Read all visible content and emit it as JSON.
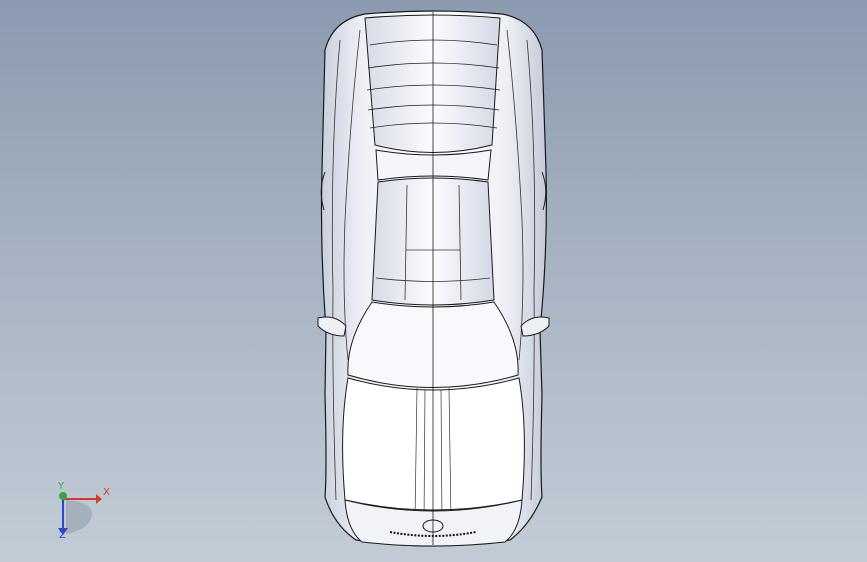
{
  "viewport": {
    "background_top": "#8b9aaf",
    "background_bottom": "#c3ccd6",
    "model": "car-body-top-view"
  },
  "triad": {
    "x_label": "X",
    "y_label": "Y",
    "z_label": "Z",
    "x_color": "#d83a2c",
    "y_color": "#3aa33a",
    "z_color": "#2f46c8"
  }
}
